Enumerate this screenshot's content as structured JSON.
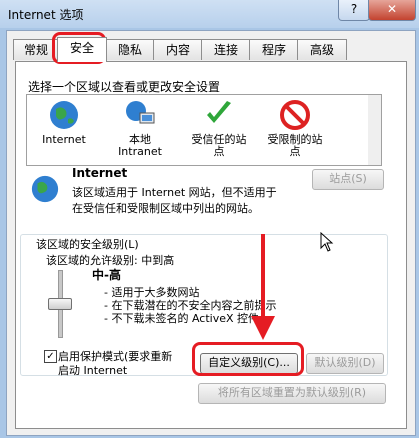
{
  "window": {
    "title": "Internet 选项",
    "help_label": "?",
    "close_label": "✕"
  },
  "tabs": [
    "常规",
    "安全",
    "隐私",
    "内容",
    "连接",
    "程序",
    "高级"
  ],
  "security": {
    "zone_prompt": "选择一个区域以查看或更改安全设置",
    "zones": [
      {
        "label": "Internet",
        "icon": "globe-icon"
      },
      {
        "label": "本地\nIntranet",
        "icon": "intranet-icon"
      },
      {
        "label": "受信任的站\n点",
        "icon": "check-icon"
      },
      {
        "label": "受限制的站\n点",
        "icon": "no-entry-icon"
      }
    ],
    "selected_zone": {
      "name": "Internet",
      "desc_line1": "该区域适用于 Internet 网站，但不适用于",
      "desc_line2": "在受信任和受限制区域中列出的网站。",
      "sites_button": "站点(S)"
    },
    "level_group_label": "该区域的安全级别(L)",
    "allowed_levels": "该区域的允许级别: 中到高",
    "level_name": "中-高",
    "level_desc": [
      "- 适用于大多数网站",
      "- 在下载潜在的不安全内容之前提示",
      "- 不下载未签名的 ActiveX 控件"
    ],
    "protected_mode_line1": "启用保护模式(要求重新",
    "protected_mode_line2": "启动 Internet",
    "protected_mode_checked": true,
    "custom_level_button": "自定义级别(C)...",
    "default_level_button": "默认级别(D)",
    "reset_all_button": "将所有区域重置为默认级别(R)"
  },
  "colors": {
    "annotation_red": "#e51c23"
  }
}
